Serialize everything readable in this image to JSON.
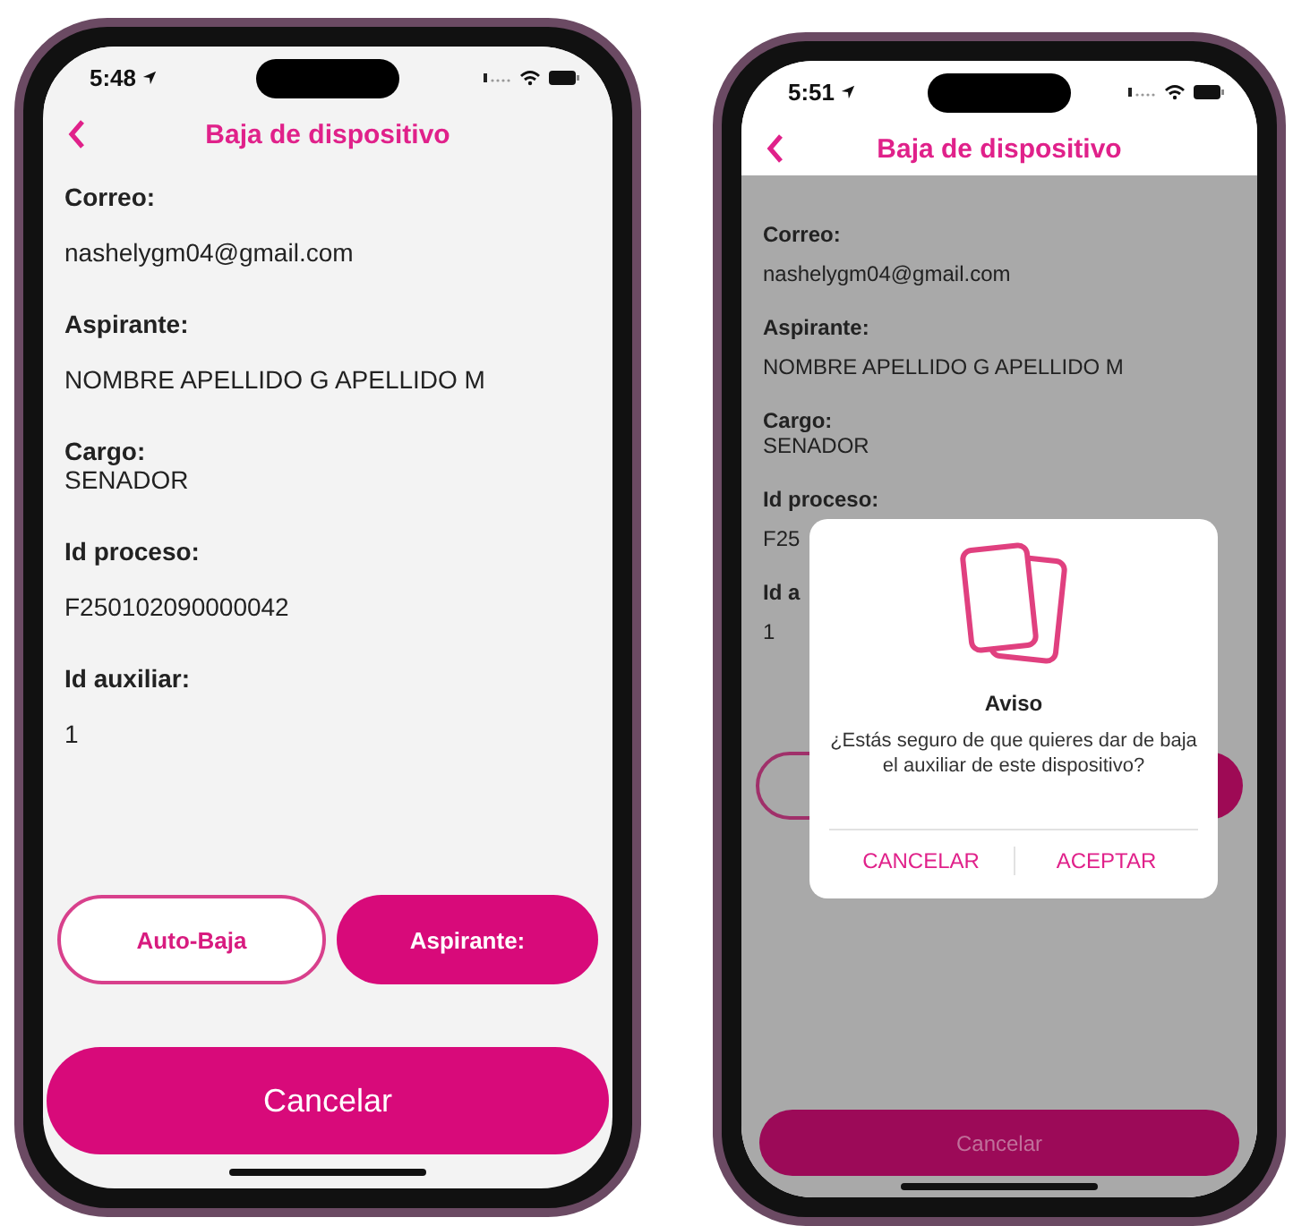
{
  "phones": [
    {
      "status_bar": {
        "time": "5:48"
      },
      "nav": {
        "title": "Baja de dispositivo"
      },
      "dimmed": false,
      "fields": [
        {
          "kind": "spaced",
          "label": "Correo:",
          "value": "nashelygm04@gmail.com"
        },
        {
          "kind": "spaced",
          "label": "Aspirante:",
          "value": "NOMBRE APELLIDO G APELLIDO M"
        },
        {
          "kind": "stacked",
          "label": "Cargo:",
          "value": "SENADOR"
        },
        {
          "kind": "spaced",
          "label": "Id proceso:",
          "value": "F250102090000042"
        },
        {
          "kind": "spaced",
          "label": "Id auxiliar:",
          "value": "1"
        }
      ],
      "buttons": [
        {
          "kind": "outline",
          "label": "Auto-Baja"
        },
        {
          "kind": "filled",
          "label": "Aspirante:"
        }
      ],
      "cancel_button": {
        "label": "Cancelar"
      }
    },
    {
      "status_bar": {
        "time": "5:51"
      },
      "nav": {
        "title": "Baja de dispositivo"
      },
      "dimmed": true,
      "fields": [
        {
          "kind": "spaced",
          "label": "Correo:",
          "value": "nashelygm04@gmail.com"
        },
        {
          "kind": "spaced",
          "label": "Aspirante:",
          "value": "NOMBRE APELLIDO G APELLIDO M"
        },
        {
          "kind": "stacked",
          "label": "Cargo:",
          "value": "SENADOR"
        },
        {
          "kind": "spaced",
          "label": "Id proceso:",
          "value": "F25"
        },
        {
          "kind": "spaced",
          "label": "Id a",
          "value": "1"
        }
      ],
      "buttons": [
        {
          "kind": "outline"
        },
        {
          "kind": "filled"
        }
      ],
      "cancel_button": {
        "label": "Cancelar"
      },
      "dialog": {
        "title": "Aviso",
        "message": "¿Estás seguro de que quieres dar de baja el auxiliar de este dispositivo?",
        "actions": [
          "CANCELAR",
          "ACEPTAR"
        ]
      }
    }
  ]
}
